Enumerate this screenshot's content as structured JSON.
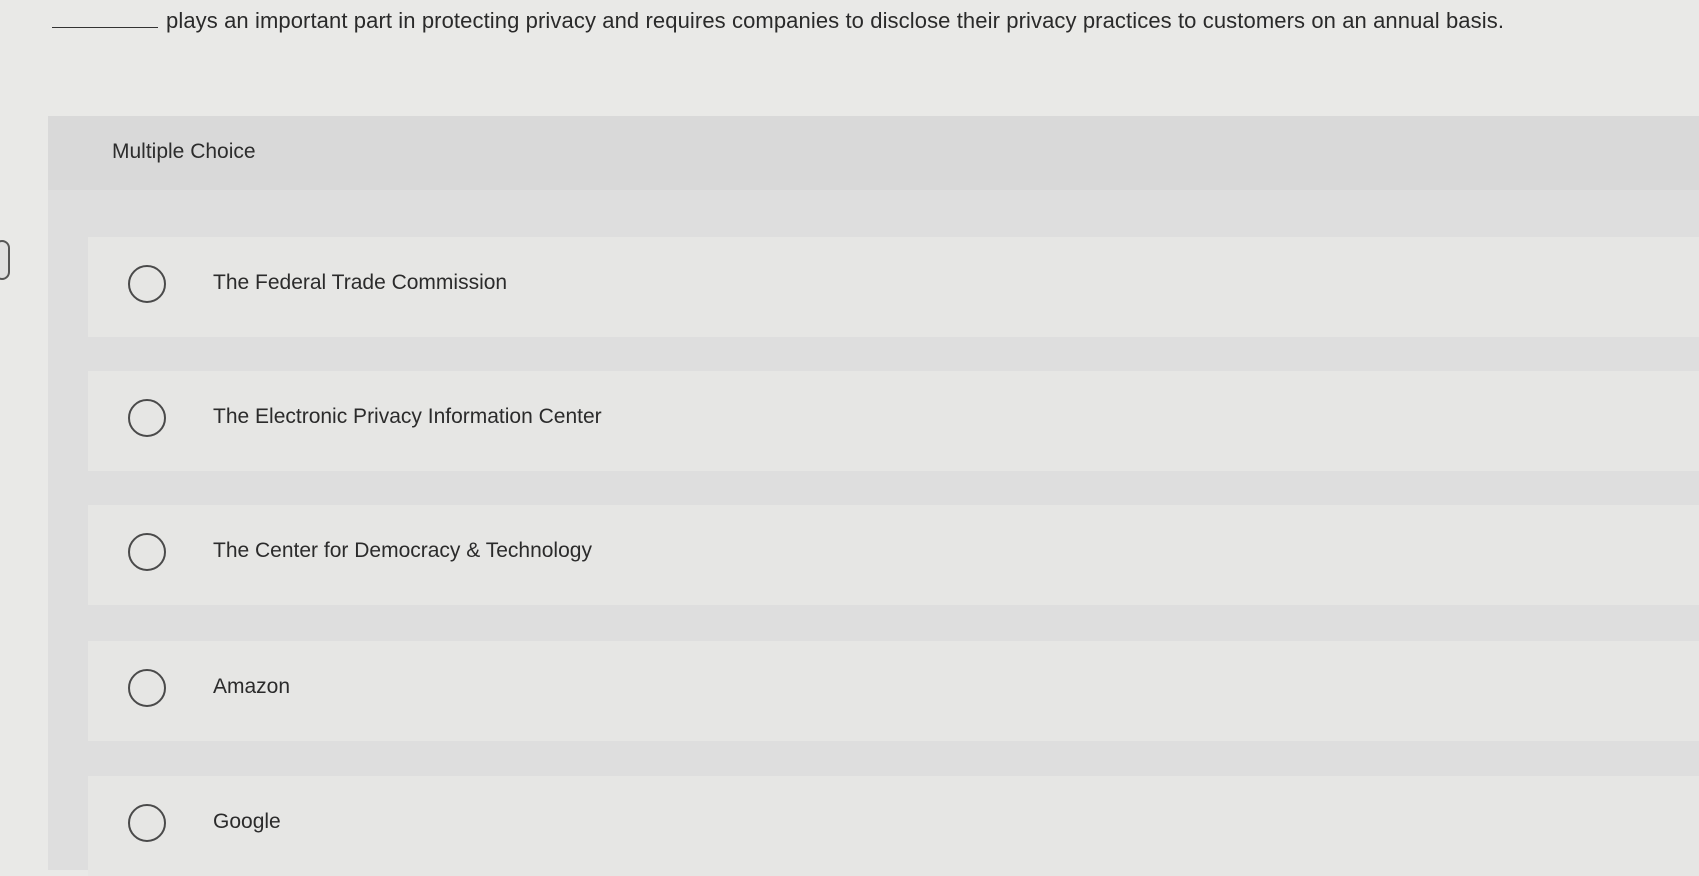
{
  "question": {
    "text": "plays an important part in protecting privacy and requires companies to disclose their privacy practices to customers on an annual basis."
  },
  "multiple_choice": {
    "title": "Multiple Choice",
    "options": [
      {
        "label": "The Federal Trade Commission"
      },
      {
        "label": "The Electronic Privacy Information Center"
      },
      {
        "label": "The Center for Democracy & Technology"
      },
      {
        "label": "Amazon"
      },
      {
        "label": "Google"
      }
    ]
  }
}
